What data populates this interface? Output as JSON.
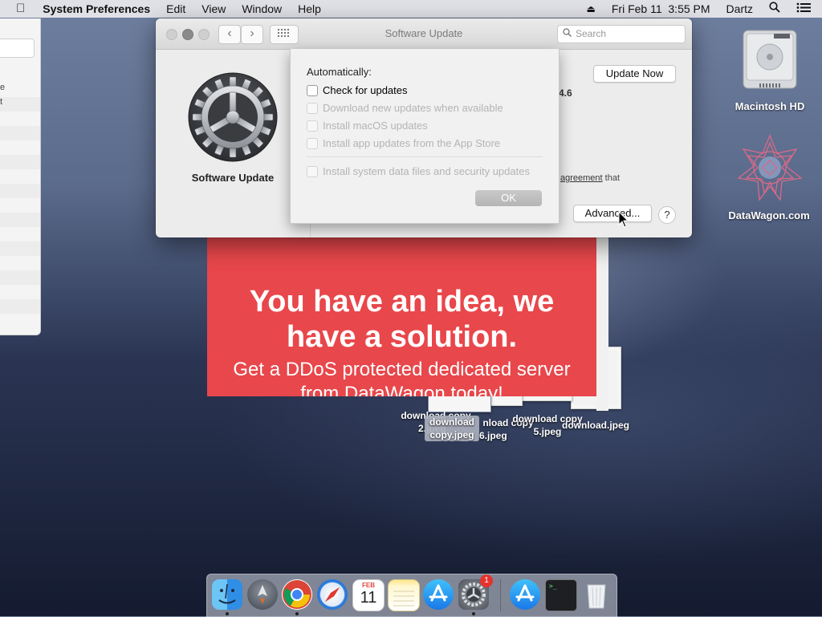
{
  "menubar": {
    "app_name": "System Preferences",
    "items": [
      "Edit",
      "View",
      "Window",
      "Help"
    ],
    "datetime": "Fri Feb 11  3:55 PM",
    "user": "Dartz"
  },
  "left_window": {
    "row_snippets": [
      "e",
      "t"
    ]
  },
  "window": {
    "title": "Software Update",
    "search_placeholder": "Search",
    "pane_label": "Software Update",
    "update_now_label": "Update Now",
    "version_partial": ".14.6",
    "agreement_partial_link": "agreement",
    "agreement_partial_rest": "that",
    "advanced_label": "Advanced...",
    "help_label": "?"
  },
  "sheet": {
    "heading": "Automatically:",
    "options": [
      {
        "label": "Check for updates",
        "checked": false,
        "enabled": true
      },
      {
        "label": "Download new updates when available",
        "checked": false,
        "enabled": false
      },
      {
        "label": "Install macOS updates",
        "checked": false,
        "enabled": false
      },
      {
        "label": "Install app updates from the App Store",
        "checked": false,
        "enabled": false
      }
    ],
    "system_option": {
      "label": "Install system data files and security updates",
      "checked": false,
      "enabled": false
    },
    "ok_label": "OK"
  },
  "ad": {
    "headline_line1": "You have an idea, we",
    "headline_line2": "have a solution.",
    "subtext_line1": "Get a DDoS protected dedicated server",
    "subtext_line2": "from DataWagon today!"
  },
  "desktop": {
    "drive_label": "Macintosh HD",
    "datawagon_label": "DataWagon.com",
    "files": [
      {
        "line1": "download copy",
        "line2": "2.jpeg"
      },
      {
        "line1": "download",
        "line2": "copy.jpeg"
      },
      {
        "line1": "nload copy",
        "line2": "6.jpeg"
      },
      {
        "line1": "download copy",
        "line2": "5.jpeg"
      },
      {
        "line1": "download.jpeg",
        "line2": ""
      }
    ]
  },
  "dock": {
    "calendar_month": "FEB",
    "calendar_day": "11",
    "sysprefs_badge": "1",
    "terminal_text": ">_"
  }
}
